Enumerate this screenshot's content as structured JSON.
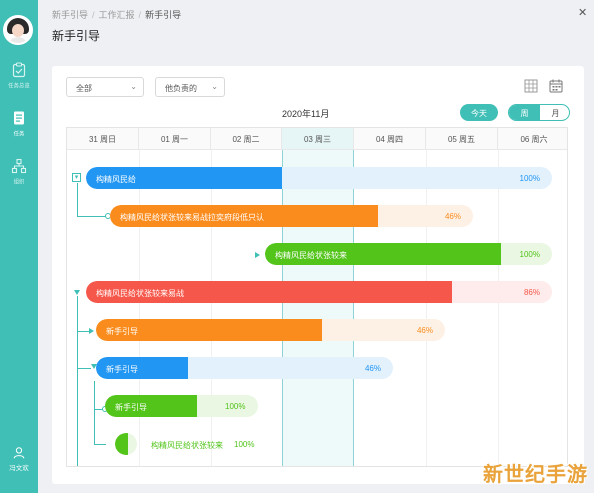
{
  "sidebar": {
    "items": [
      {
        "label": "任务总览",
        "icon": "clipboard-icon"
      },
      {
        "label": "任务",
        "icon": "document-icon"
      },
      {
        "label": "组织",
        "icon": "org-chart-icon"
      }
    ],
    "user_label": "冯文欢",
    "user_icon": "user-icon"
  },
  "header": {
    "breadcrumb": [
      "新手引导",
      "工作汇报",
      "新手引导"
    ],
    "title": "新手引导"
  },
  "filters": {
    "scope": "全部",
    "owner": "他负责的"
  },
  "calendar": {
    "month": "2020年11月",
    "today_label": "今天",
    "week_label": "周",
    "month_label": "月",
    "days": [
      "31 周日",
      "01 周一",
      "02 周二",
      "03 周三",
      "04 周四",
      "05 周五",
      "06 周六"
    ]
  },
  "tasks": [
    {
      "name": "构精风民给",
      "progress": "100%",
      "color": "#2196f3",
      "track": "#e3f1fd",
      "pct_color": "#2196f3",
      "label_inside": true
    },
    {
      "name": "构精风民给状张较来易战拉奕府段低只认",
      "progress": "46%",
      "color": "#fa8c1e",
      "track": "#fdf0e4",
      "pct_color": "#fa8c1e",
      "label_inside": true
    },
    {
      "name": "构精风民给状张较来",
      "progress": "100%",
      "color": "#52c41a",
      "track": "#eaf7e3",
      "pct_color": "#52c41a",
      "label_inside": true
    },
    {
      "name": "构精风民给状张较来易战",
      "progress": "86%",
      "color": "#f5574a",
      "track": "#fdeceb",
      "pct_color": "#f5574a",
      "label_inside": true
    },
    {
      "name": "新手引导",
      "progress": "46%",
      "color": "#fa8c1e",
      "track": "#fdf0e4",
      "pct_color": "#fa8c1e",
      "label_inside": true
    },
    {
      "name": "新手引导",
      "progress": "46%",
      "color": "#2196f3",
      "track": "#e3f1fd",
      "pct_color": "#2196f3",
      "label_inside": true
    },
    {
      "name": "新手引导",
      "progress": "100%",
      "color": "#52c41a",
      "track": "#eaf7e3",
      "pct_color": "#52c41a",
      "label_inside": true
    },
    {
      "name": "构精风民给状张较来",
      "progress": "100%",
      "color": "#52c41a",
      "track": "#ffffff",
      "pct_color": "#52c41a",
      "label_inside": false
    }
  ],
  "icons": {
    "close": "close-icon",
    "grid_view": "grid-view-icon",
    "calendar_view": "calendar-icon"
  },
  "watermark": "新世纪手游",
  "colors": {
    "accent": "#3fbfb6",
    "blue": "#2196f3",
    "orange": "#fa8c1e",
    "green": "#52c41a",
    "red": "#f5574a"
  }
}
